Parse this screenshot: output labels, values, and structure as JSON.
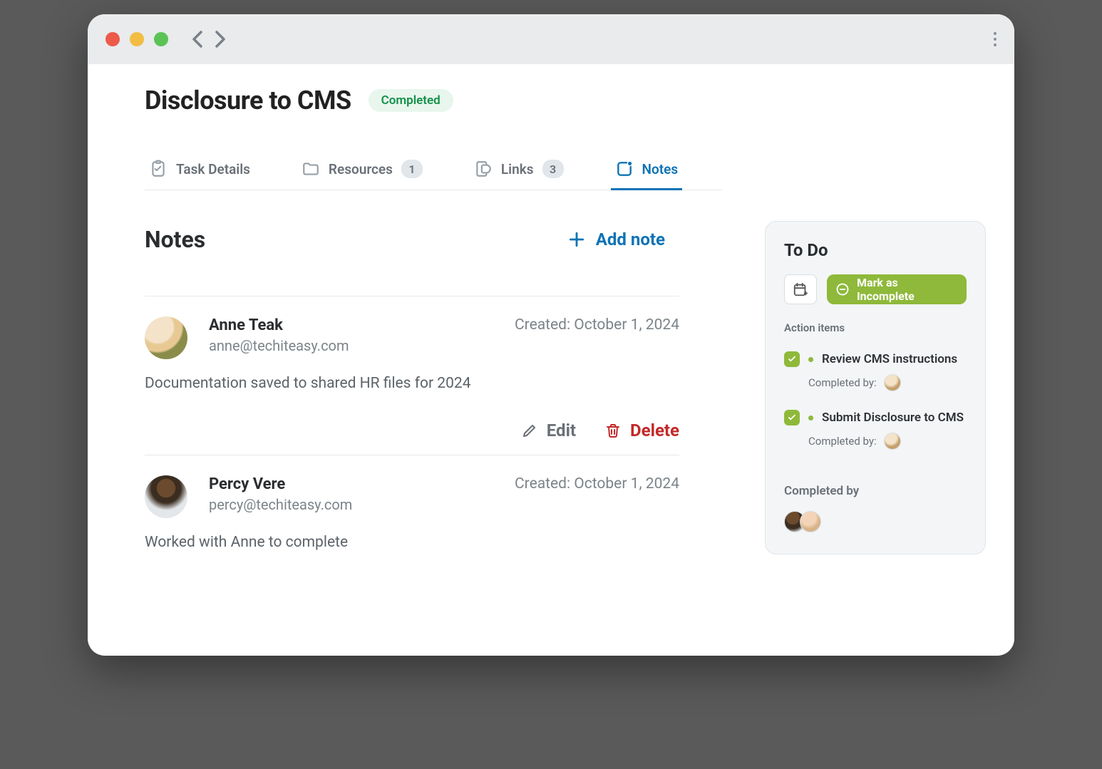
{
  "page": {
    "title": "Disclosure to CMS",
    "status_label": "Completed"
  },
  "tabs": {
    "task_details": "Task Details",
    "resources": "Resources",
    "resources_count": "1",
    "links": "Links",
    "links_count": "3",
    "notes": "Notes"
  },
  "notes_section": {
    "heading": "Notes",
    "add_label": "Add note"
  },
  "notes": [
    {
      "name": "Anne Teak",
      "email": "anne@techiteasy.com",
      "created_label": "Created: October 1, 2024",
      "body": "Documentation saved to shared HR files for 2024",
      "edit_label": "Edit",
      "delete_label": "Delete",
      "avatar": "anne"
    },
    {
      "name": "Percy Vere",
      "email": "percy@techiteasy.com",
      "created_label": "Created: October 1, 2024",
      "body": "Worked with Anne to complete",
      "avatar": "percy"
    }
  ],
  "sidebar": {
    "heading": "To Do",
    "mark_incomplete": "Mark as Incomplete",
    "action_items_label": "Action items",
    "items": [
      {
        "text": "Review CMS instructions",
        "completed_by_label": "Completed by:"
      },
      {
        "text": "Submit Disclosure to CMS",
        "completed_by_label": "Completed by:"
      }
    ],
    "completed_by_label": "Completed by"
  }
}
